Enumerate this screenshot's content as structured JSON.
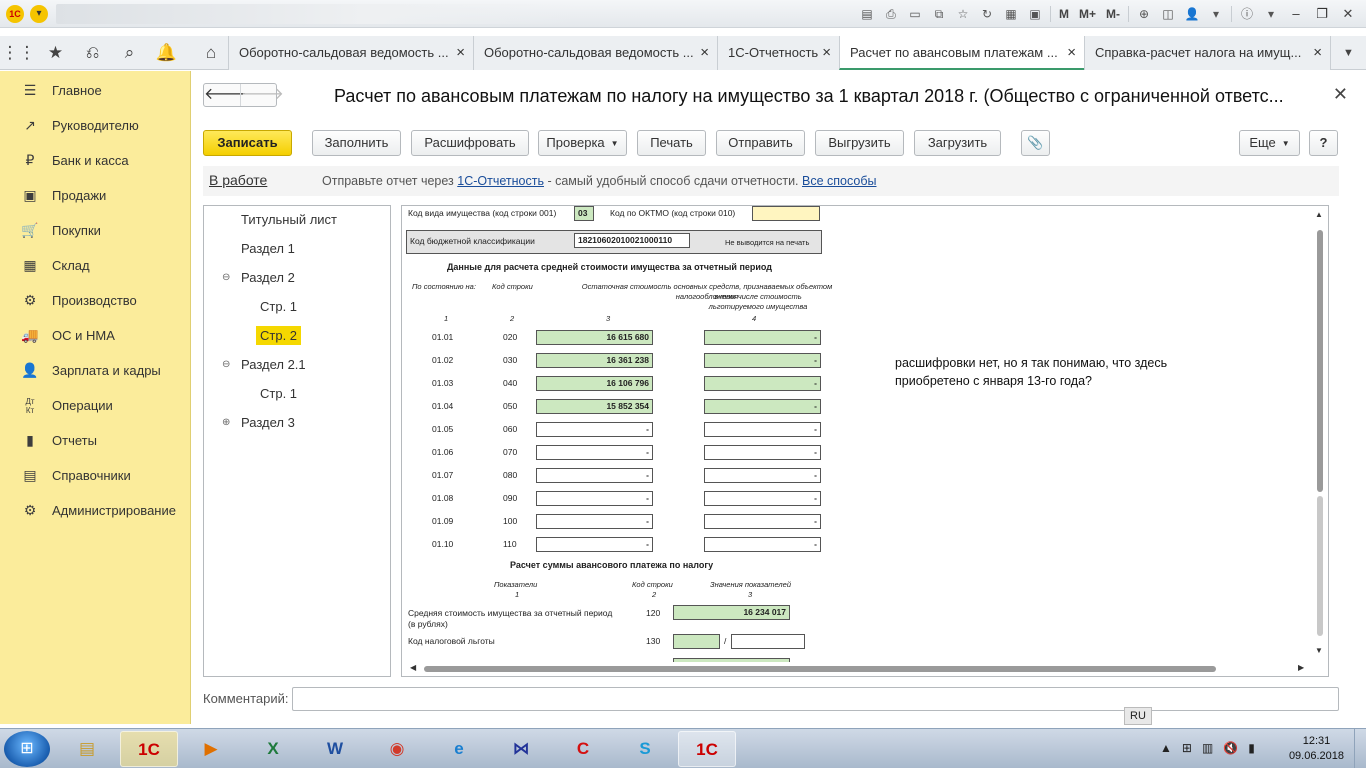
{
  "titlebar": {
    "logo": "1С",
    "tools": [
      "M",
      "M+",
      "M-"
    ]
  },
  "tabs": [
    {
      "label": "Оборотно-сальдовая ведомость ..."
    },
    {
      "label": "Оборотно-сальдовая ведомость ..."
    },
    {
      "label": "1С-Отчетность"
    },
    {
      "label": "Расчет по авансовым платежам ...",
      "active": true
    },
    {
      "label": "Справка-расчет налога на имущ..."
    }
  ],
  "sidebar": {
    "items": [
      {
        "icon": "menu-icon",
        "label": "Главное"
      },
      {
        "icon": "trend-icon",
        "label": "Руководителю"
      },
      {
        "icon": "ruble-coin-icon",
        "label": "Банк и касса"
      },
      {
        "icon": "shopping-bag-icon",
        "label": "Продажи"
      },
      {
        "icon": "cart-icon",
        "label": "Покупки"
      },
      {
        "icon": "warehouse-icon",
        "label": "Склад"
      },
      {
        "icon": "factory-icon",
        "label": "Производство"
      },
      {
        "icon": "truck-icon",
        "label": "ОС и НМА"
      },
      {
        "icon": "person-icon",
        "label": "Зарплата и кадры"
      },
      {
        "icon": "dt-kt-icon",
        "label": "Операции"
      },
      {
        "icon": "bar-chart-icon",
        "label": "Отчеты"
      },
      {
        "icon": "book-icon",
        "label": "Справочники"
      },
      {
        "icon": "gear-icon",
        "label": "Администрирование"
      }
    ]
  },
  "document": {
    "title": "Расчет по авансовым платежам по налогу на имущество за 1 квартал 2018 г. (Общество с ограниченной ответс...",
    "toolbar": {
      "save": "Записать",
      "fill": "Заполнить",
      "decode": "Расшифровать",
      "check": "Проверка",
      "print": "Печать",
      "send": "Отправить",
      "export": "Выгрузить",
      "import": "Загрузить",
      "more": "Еще",
      "help": "?"
    },
    "status": "В работе",
    "info": {
      "prefix": "Отправьте отчет через",
      "link1": "1С-Отчетность",
      "middle": "- самый удобный способ сдачи отчетности.",
      "link2": "Все способы"
    },
    "comment_label": "Комментарий:",
    "comment_value": ""
  },
  "tree": [
    {
      "label": "Титульный лист",
      "level": 0
    },
    {
      "label": "Раздел 1",
      "level": 0
    },
    {
      "label": "Раздел 2",
      "level": 0,
      "toggle": "⊖"
    },
    {
      "label": "Стр. 1",
      "level": 1
    },
    {
      "label": "Стр. 2",
      "level": 1,
      "selected": true
    },
    {
      "label": "Раздел 2.1",
      "level": 0,
      "toggle": "⊖"
    },
    {
      "label": "Стр. 1",
      "level": 1
    },
    {
      "label": "Раздел 3",
      "level": 0,
      "toggle": "⊕"
    }
  ],
  "form": {
    "property_type_label": "Код вида имущества (код строки 001)",
    "property_type_value": "03",
    "oktmo_label": "Код по ОКТМО (код строки 010)",
    "kbk_label": "Код бюджетной классификации",
    "kbk_value": "18210602010021000110",
    "no_print": "Не выводится на печать",
    "section_title": "Данные для расчета средней стоимости имущества за отчетный период",
    "col_as_of": "По состоянию на:",
    "col_code": "Код строки",
    "col_residual": "Остаточная стоимость основных средств, признаваемых объектом налогообложения",
    "col_privileged": "в том числе стоимость льготируемого имущества",
    "col_nums": [
      "1",
      "2",
      "3",
      "4"
    ],
    "rows": [
      {
        "date": "01.01",
        "code": "020",
        "value": "16 615 680",
        "priv": "-"
      },
      {
        "date": "01.02",
        "code": "030",
        "value": "16 361 238",
        "priv": "-"
      },
      {
        "date": "01.03",
        "code": "040",
        "value": "16 106 796",
        "priv": "-"
      },
      {
        "date": "01.04",
        "code": "050",
        "value": "15 852 354",
        "priv": "-"
      },
      {
        "date": "01.05",
        "code": "060",
        "value": "-",
        "priv": "-"
      },
      {
        "date": "01.06",
        "code": "070",
        "value": "-",
        "priv": "-"
      },
      {
        "date": "01.07",
        "code": "080",
        "value": "-",
        "priv": "-"
      },
      {
        "date": "01.08",
        "code": "090",
        "value": "-",
        "priv": "-"
      },
      {
        "date": "01.09",
        "code": "100",
        "value": "-",
        "priv": "-"
      },
      {
        "date": "01.10",
        "code": "110",
        "value": "-",
        "priv": "-"
      }
    ],
    "calc_title": "Расчет суммы авансового платежа по налогу",
    "calc_col1": "Показатели",
    "calc_col2": "Код строки",
    "calc_col3": "Значения показателей",
    "calc_nums": [
      "1",
      "2",
      "3"
    ],
    "avg_label": "Средняя стоимость имущества за отчетный период",
    "avg_label2": "(в рублях)",
    "avg_code": "120",
    "avg_value": "16 234 017",
    "benefit_label": "Код налоговой льготы",
    "benefit_code": "130",
    "benefit_sep": "/",
    "note": "расшифровки нет, но я так понимаю, что здесь приобретено с января 13-го года?"
  },
  "taskbar": {
    "lang": "RU",
    "time": "12:31",
    "date": "09.06.2018"
  }
}
